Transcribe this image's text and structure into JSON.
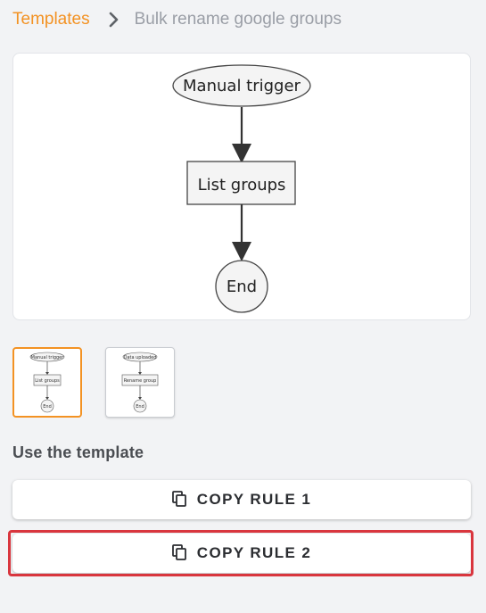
{
  "breadcrumb": {
    "root": "Templates",
    "current": "Bulk rename google groups"
  },
  "diagram": {
    "nodes": [
      "Manual trigger",
      "List groups",
      "End"
    ]
  },
  "thumbnails": [
    {
      "nodes": [
        "Manual trigger",
        "List groups",
        "End"
      ],
      "selected": true
    },
    {
      "nodes": [
        "Data uploaded",
        "Rename group",
        "End"
      ],
      "selected": false
    }
  ],
  "section": {
    "title": "Use the template"
  },
  "buttons": [
    {
      "label": "COPY RULE 1",
      "icon": "copy-icon"
    },
    {
      "label": "COPY RULE 2",
      "icon": "copy-icon",
      "highlighted": true
    }
  ],
  "colors": {
    "accent": "#f39223",
    "highlight": "#d9363e"
  }
}
